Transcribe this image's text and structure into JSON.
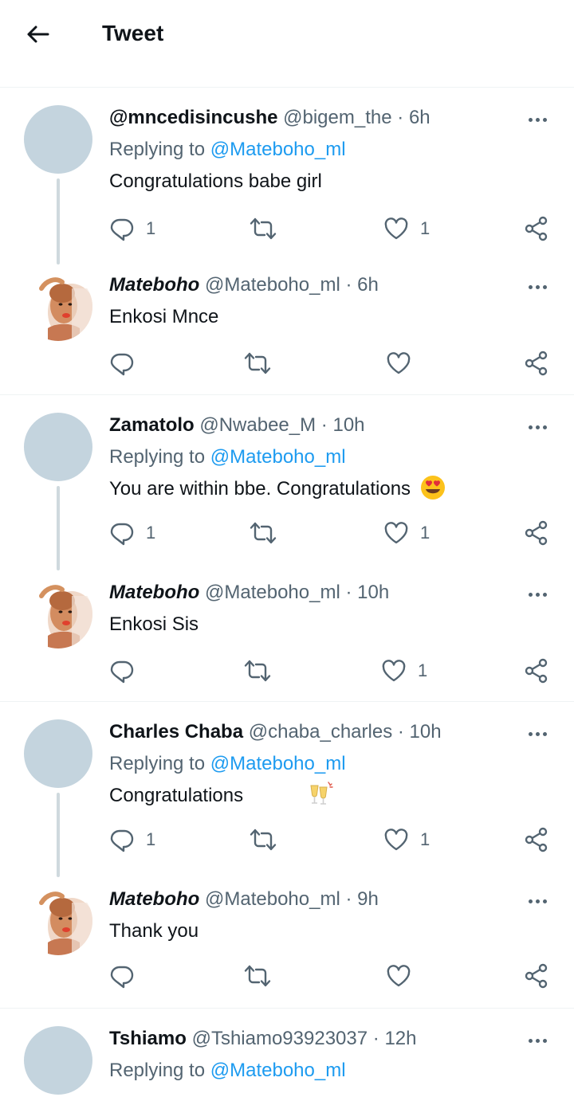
{
  "header": {
    "title": "Tweet",
    "back_icon": "arrow-left-icon"
  },
  "colors": {
    "link": "#1d9bf0",
    "secondary": "#536471",
    "text": "#0f1419",
    "avatar_placeholder": "#c4d4de"
  },
  "replies": [
    {
      "name": "@mncedisincushe",
      "handle": "@bigem_the",
      "dot": "·",
      "time": "6h",
      "replying_prefix": "Replying to",
      "mention": "@Mateboho_ml",
      "text": "Congratulations babe girl",
      "reply_count": "1",
      "retweet_count": "",
      "like_count": "1"
    },
    {
      "name": "Mateboho",
      "handle": "@Mateboho_ml",
      "dot": "·",
      "time": "6h",
      "text": "Enkosi Mnce",
      "reply_count": "",
      "retweet_count": "",
      "like_count": ""
    },
    {
      "name": "Zamatolo",
      "handle": "@Nwabee_M",
      "dot": "·",
      "time": "10h",
      "replying_prefix": "Replying to",
      "mention": "@Mateboho_ml",
      "text": "You are within bbe. Congratulations",
      "emoji": "smiling-face-with-heart-eyes",
      "reply_count": "1",
      "retweet_count": "",
      "like_count": "1"
    },
    {
      "name": "Mateboho",
      "handle": "@Mateboho_ml",
      "dot": "·",
      "time": "10h",
      "text": "Enkosi Sis",
      "reply_count": "",
      "retweet_count": "",
      "like_count": "1"
    },
    {
      "name": "Charles Chaba",
      "handle": "@chaba_charles",
      "dot": "·",
      "time": "10h",
      "replying_prefix": "Replying to",
      "mention": "@Mateboho_ml",
      "text": "Congratulations",
      "emoji": "clinking-glasses",
      "reply_count": "1",
      "retweet_count": "",
      "like_count": "1"
    },
    {
      "name": "Mateboho",
      "handle": "@Mateboho_ml",
      "dot": "·",
      "time": "9h",
      "text": "Thank you",
      "reply_count": "",
      "retweet_count": "",
      "like_count": ""
    },
    {
      "name": "Tshiamo",
      "handle": "@Tshiamo93923037",
      "dot": "·",
      "time": "12h",
      "replying_prefix": "Replying to",
      "mention": "@Mateboho_ml"
    }
  ]
}
